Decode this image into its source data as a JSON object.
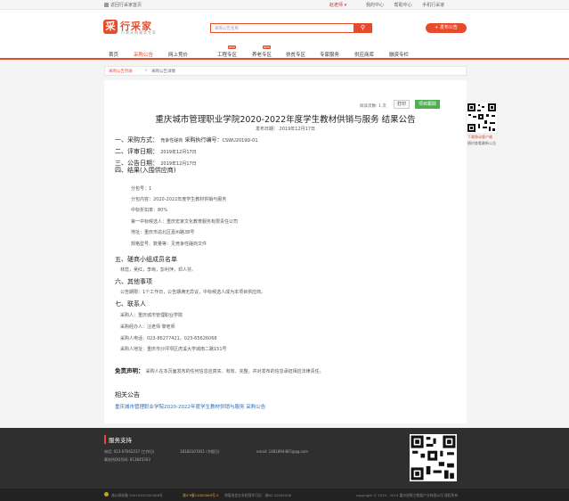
{
  "topbar": {
    "home": "返回行采家首页",
    "user": "赵老师 ▾",
    "links": [
      "我的中心",
      "帮助中心",
      "手机行采家"
    ]
  },
  "header": {
    "logo_char": "采",
    "logo_text": "行采家",
    "logo_sub": "行政采购服务专家",
    "search_placeholder": "采购公告名称",
    "publish_label": "+ 发布公告"
  },
  "nav": {
    "items": [
      "首页",
      "采购公告",
      "网上竞价",
      "工程专区",
      "养老专区",
      "扶贫专区",
      "专家服务",
      "供应商库",
      "融资专栏"
    ],
    "hot_label": "NEW"
  },
  "breadcrumb": {
    "current": "采购公告列表",
    "sep": ">",
    "page": "采购公告详情"
  },
  "article": {
    "meta": "阅读次数: 1 次",
    "print_label": "打印",
    "project_label": "项目跟踪",
    "title": "重庆城市管理职业学院2020-2022年度学生教材供销与服务 结果公告",
    "publish_date": "发布日期： 2019年12月17日",
    "s1_label": "一、采购方式：",
    "s1_method": "竞争性磋商",
    "s1_code": "采购执行编号：",
    "s1_code_val": "CSWU2019D-01",
    "s2_label": "二、评审日期：",
    "s2_val": "2019年12月17日",
    "s3_label": "三、公告日期：",
    "s3_val": "2019年12月17日",
    "s4_label": "四、结果(入围供应商)",
    "result_lines": [
      "分包号：1",
      "分包内容：2020-2022年度学生教材供销与服务",
      "中标折扣率：80%",
      "第一中标候选人：重庆宏家文化教育服务有限责任公司",
      "地址：重庆市渝北区嘉州路38号",
      "规格型号、数量等：见竞争性磋商文件"
    ],
    "s5_label": "五、磋商小组成员名单",
    "s5_val": "林蕊，吴红，李峋，彭利萍，邓人芬。",
    "s6_label": "六、其他事项",
    "s6_val": "公告期限：1个工作日，公告期满无异议，中标候选人成为本项目供应商。",
    "s7_label": "七、联系人",
    "contact_lines": [
      "采购人：重庆城市管理职业学院",
      "采购经办人：汪老师 黎老师",
      "采购人电话：023-86277421，023-65626068",
      "采购人地址：重庆市沙坪坝区虎溪大学城南二路151号"
    ],
    "disclaimer_label": "免责声明：",
    "disclaimer_text": "采购人在本页面发布的任何信息应真实、有效、完整，并对发布的信息承担相应法律责任。",
    "related_label": "相关公告",
    "related_link": "重庆城市管理职业学院2020-2022年度学生教材供销与服务 采购公告"
  },
  "side": {
    "qr_text1": "下载移动客户端",
    "qr_text2": "随时查看最新公告"
  },
  "footer": {
    "title": "服务支持",
    "phone": "电话: 023-67662237 (工作日)",
    "phone2": "18183107831 (节假日)",
    "email": "email: 1481894487@qq.com",
    "qq": "事务所QQ号码: 813845303",
    "b1": "渝公网安备 50010302000496号",
    "b2": "渝ICP备14000969号-5",
    "b3": "增值电信业务经营许可证：渝B2-20180006",
    "b4": "copyright © 2019 - 2019 重庆逆戟大数据产业有限公司 版权所有"
  }
}
